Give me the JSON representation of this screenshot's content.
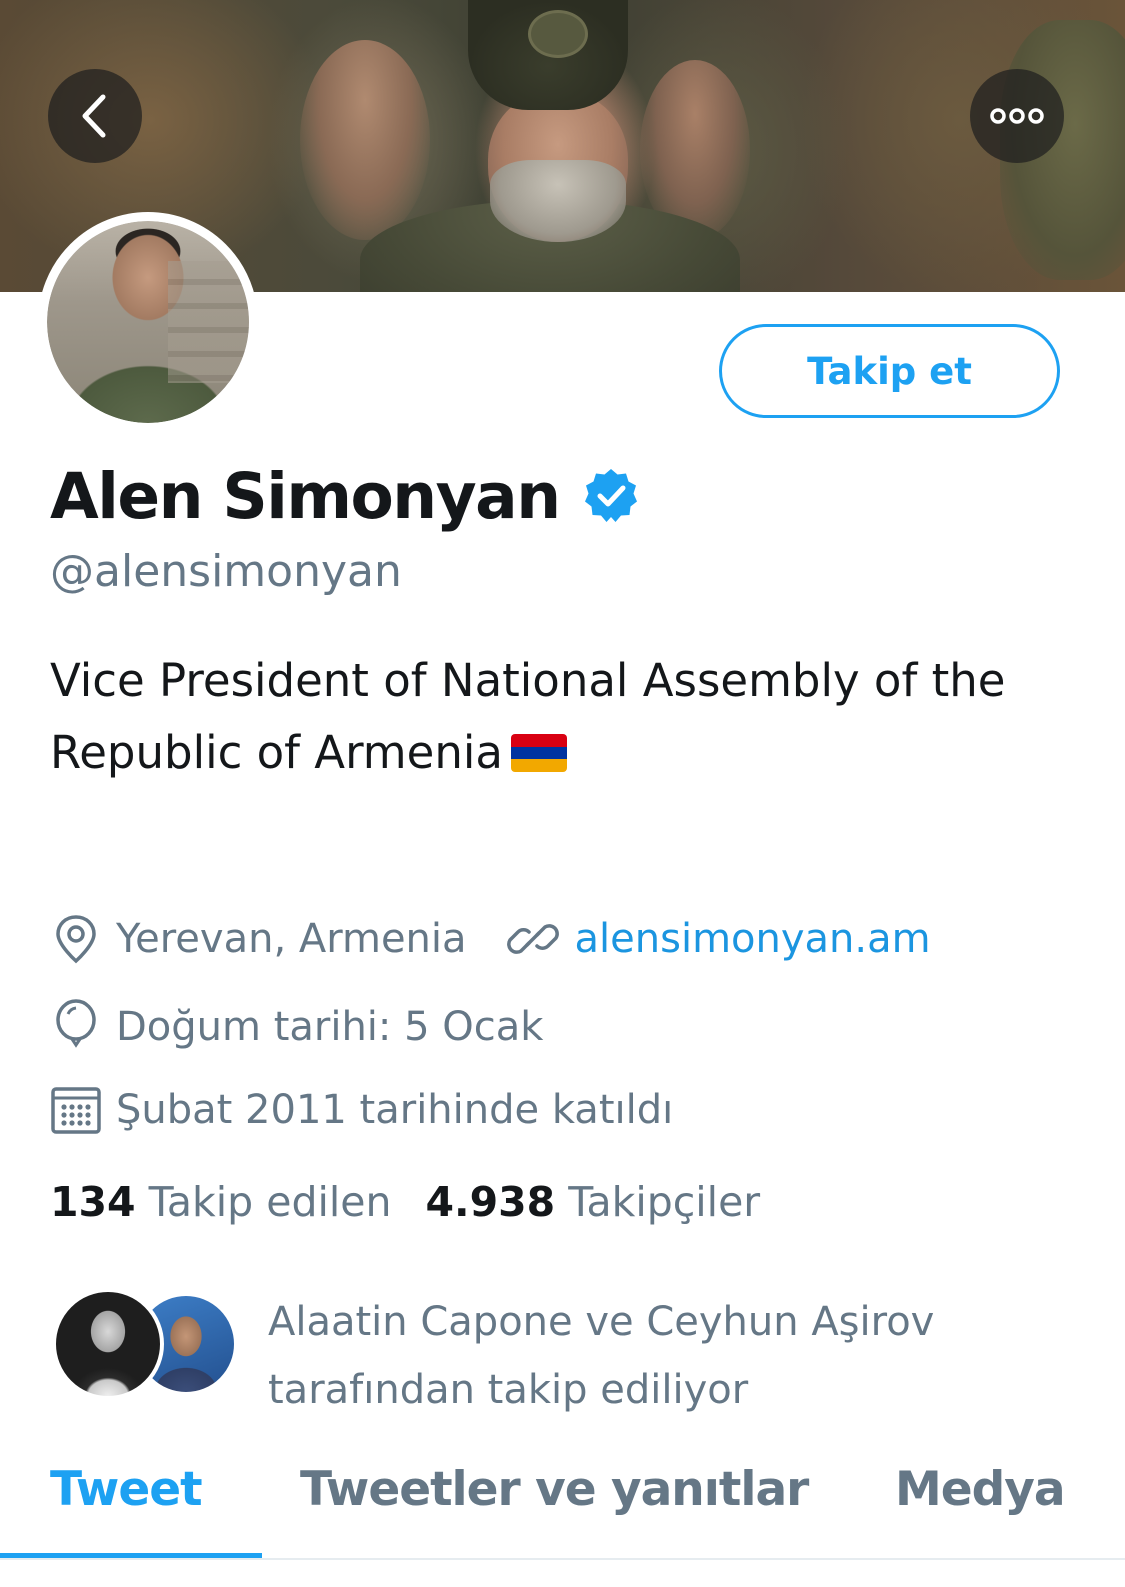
{
  "header": {
    "back_icon": "chevron-left-icon",
    "more_icon": "more-horizontal-icon"
  },
  "profile": {
    "name": "Alen Simonyan",
    "verified": true,
    "handle": "@alensimonyan",
    "bio": "Vice President of National Assembly of the Republic of Armenia",
    "bio_flag": "armenia-flag",
    "follow_label": "Takip et",
    "location": "Yerevan, Armenia",
    "website": "alensimonyan.am",
    "birthday": "Doğum tarihi: 5 Ocak",
    "joined": "Şubat 2011 tarihinde katıldı",
    "following_count": "134",
    "following_label": "Takip edilen",
    "followers_count": "4.938",
    "followers_label": "Takipçiler",
    "followed_by_line1": "Alaatin Capone ve Ceyhun Aşirov",
    "followed_by_line2": "tarafından takip ediliyor"
  },
  "tabs": [
    {
      "label": "Tweet",
      "active": true
    },
    {
      "label": "Tweetler ve yanıtlar",
      "active": false
    },
    {
      "label": "Medya",
      "active": false
    }
  ],
  "colors": {
    "accent": "#1da1f2",
    "link": "#1b95e0",
    "secondary_text": "#657786",
    "primary_text": "#14171a",
    "flag_red": "#d90012",
    "flag_blue": "#0033a0",
    "flag_orange": "#f2a800"
  }
}
